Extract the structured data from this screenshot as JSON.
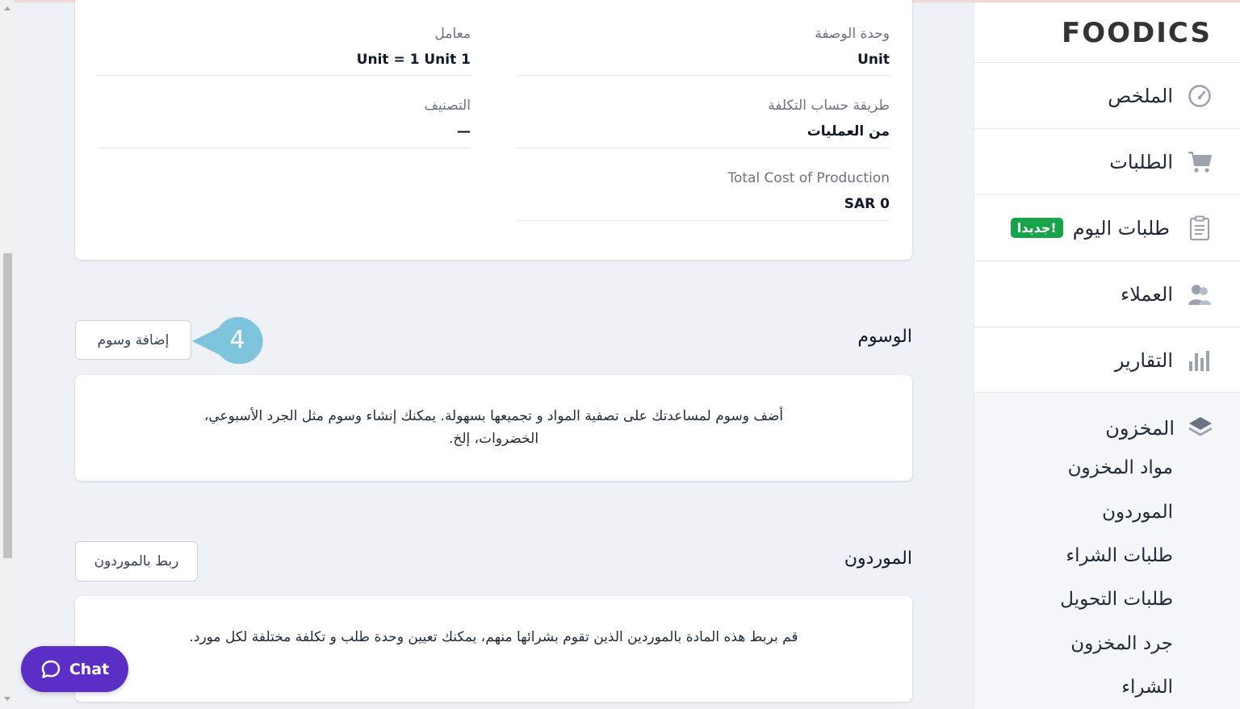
{
  "details": {
    "fields": [
      {
        "label": "وحدة الوصفة",
        "value": "Unit"
      },
      {
        "label": "معامل",
        "value": "1 Unit = 1 Unit"
      },
      {
        "label": "طريقة حساب التكلفة",
        "value": "من العمليات"
      },
      {
        "label": "التصنيف",
        "value": "—"
      },
      {
        "label": "Total Cost of Production",
        "value": "SAR 0"
      }
    ]
  },
  "tags": {
    "title": "الوسوم",
    "button_label": "إضافة وسوم",
    "description": "أضف وسوم لمساعدتك على تصفية المواد و تجميعها بسهولة. يمكنك إنشاء وسوم مثل الجرد الأسبوعي، الخضروات، إلخ."
  },
  "step_marker": {
    "number": "4",
    "color": "#7ec4dc"
  },
  "suppliers": {
    "title": "الموردون",
    "button_label": "ربط بالموردون",
    "description": "قم بربط هذه المادة بالموردين الذين تقوم بشرائها منهم، يمكنك تعيين وحدة طلب و تكلفة مختلفة لكل مورد."
  },
  "chat": {
    "label": "Chat",
    "color": "#5b2fc5"
  },
  "sidebar": {
    "logo": "FOODICS",
    "items": [
      {
        "label": "الملخص",
        "icon": "dashboard-gauge-icon"
      },
      {
        "label": "الطلبات",
        "icon": "cart-icon"
      },
      {
        "label": "طلبات اليوم",
        "icon": "clipboard-icon",
        "badge": "جديدا!"
      },
      {
        "label": "العملاء",
        "icon": "customers-icon"
      },
      {
        "label": "التقارير",
        "icon": "bar-chart-icon"
      }
    ],
    "inventory": {
      "label": "المخزون",
      "icon": "layers-icon",
      "sub_items": [
        "مواد المخزون",
        "الموردون",
        "طلبات الشراء",
        "طلبات التحويل",
        "جرد المخزون",
        "الشراء"
      ]
    },
    "badge_color": "#16a34a"
  }
}
